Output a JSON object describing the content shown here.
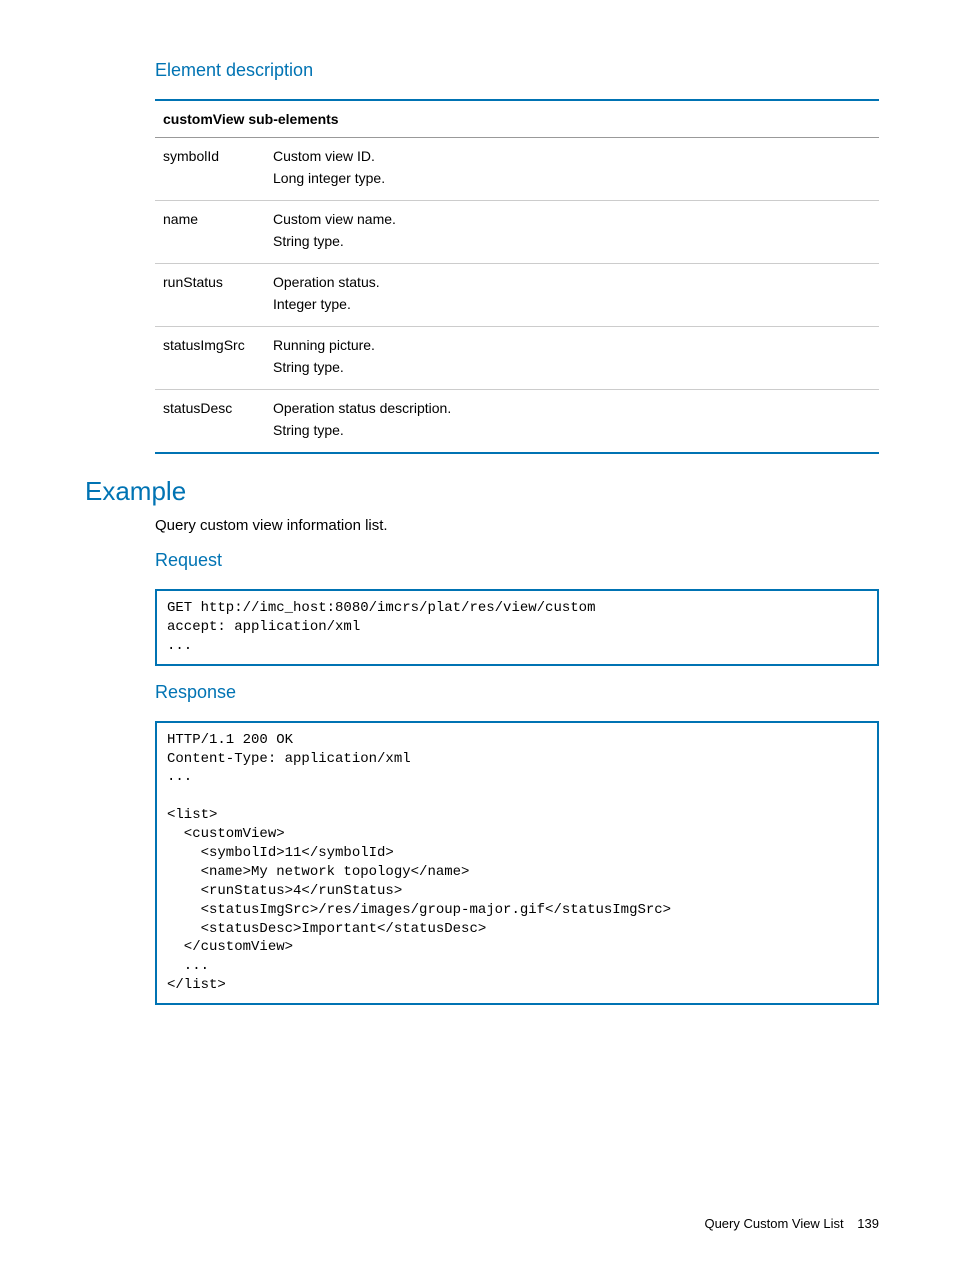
{
  "headings": {
    "element_description": "Element description",
    "example": "Example",
    "request": "Request",
    "response": "Response"
  },
  "table": {
    "header": "customView sub-elements",
    "rows": [
      {
        "name": "symbolId",
        "line1": "Custom view ID.",
        "line2": "Long integer type."
      },
      {
        "name": "name",
        "line1": "Custom view name.",
        "line2": "String type."
      },
      {
        "name": "runStatus",
        "line1": "Operation status.",
        "line2": "Integer type."
      },
      {
        "name": "statusImgSrc",
        "line1": "Running picture.",
        "line2": "String type."
      },
      {
        "name": "statusDesc",
        "line1": "Operation status description.",
        "line2": "String type."
      }
    ]
  },
  "example_intro": "Query custom view information list.",
  "request_code": "GET http://imc_host:8080/imcrs/plat/res/view/custom\naccept: application/xml\n...",
  "response_code": "HTTP/1.1 200 OK\nContent-Type: application/xml\n...\n\n<list>\n  <customView>\n    <symbolId>11</symbolId>\n    <name>My network topology</name>\n    <runStatus>4</runStatus>\n    <statusImgSrc>/res/images/group-major.gif</statusImgSrc>\n    <statusDesc>Important</statusDesc>\n  </customView>\n  ...\n</list>",
  "footer": {
    "title": "Query Custom View List",
    "page": "139"
  }
}
